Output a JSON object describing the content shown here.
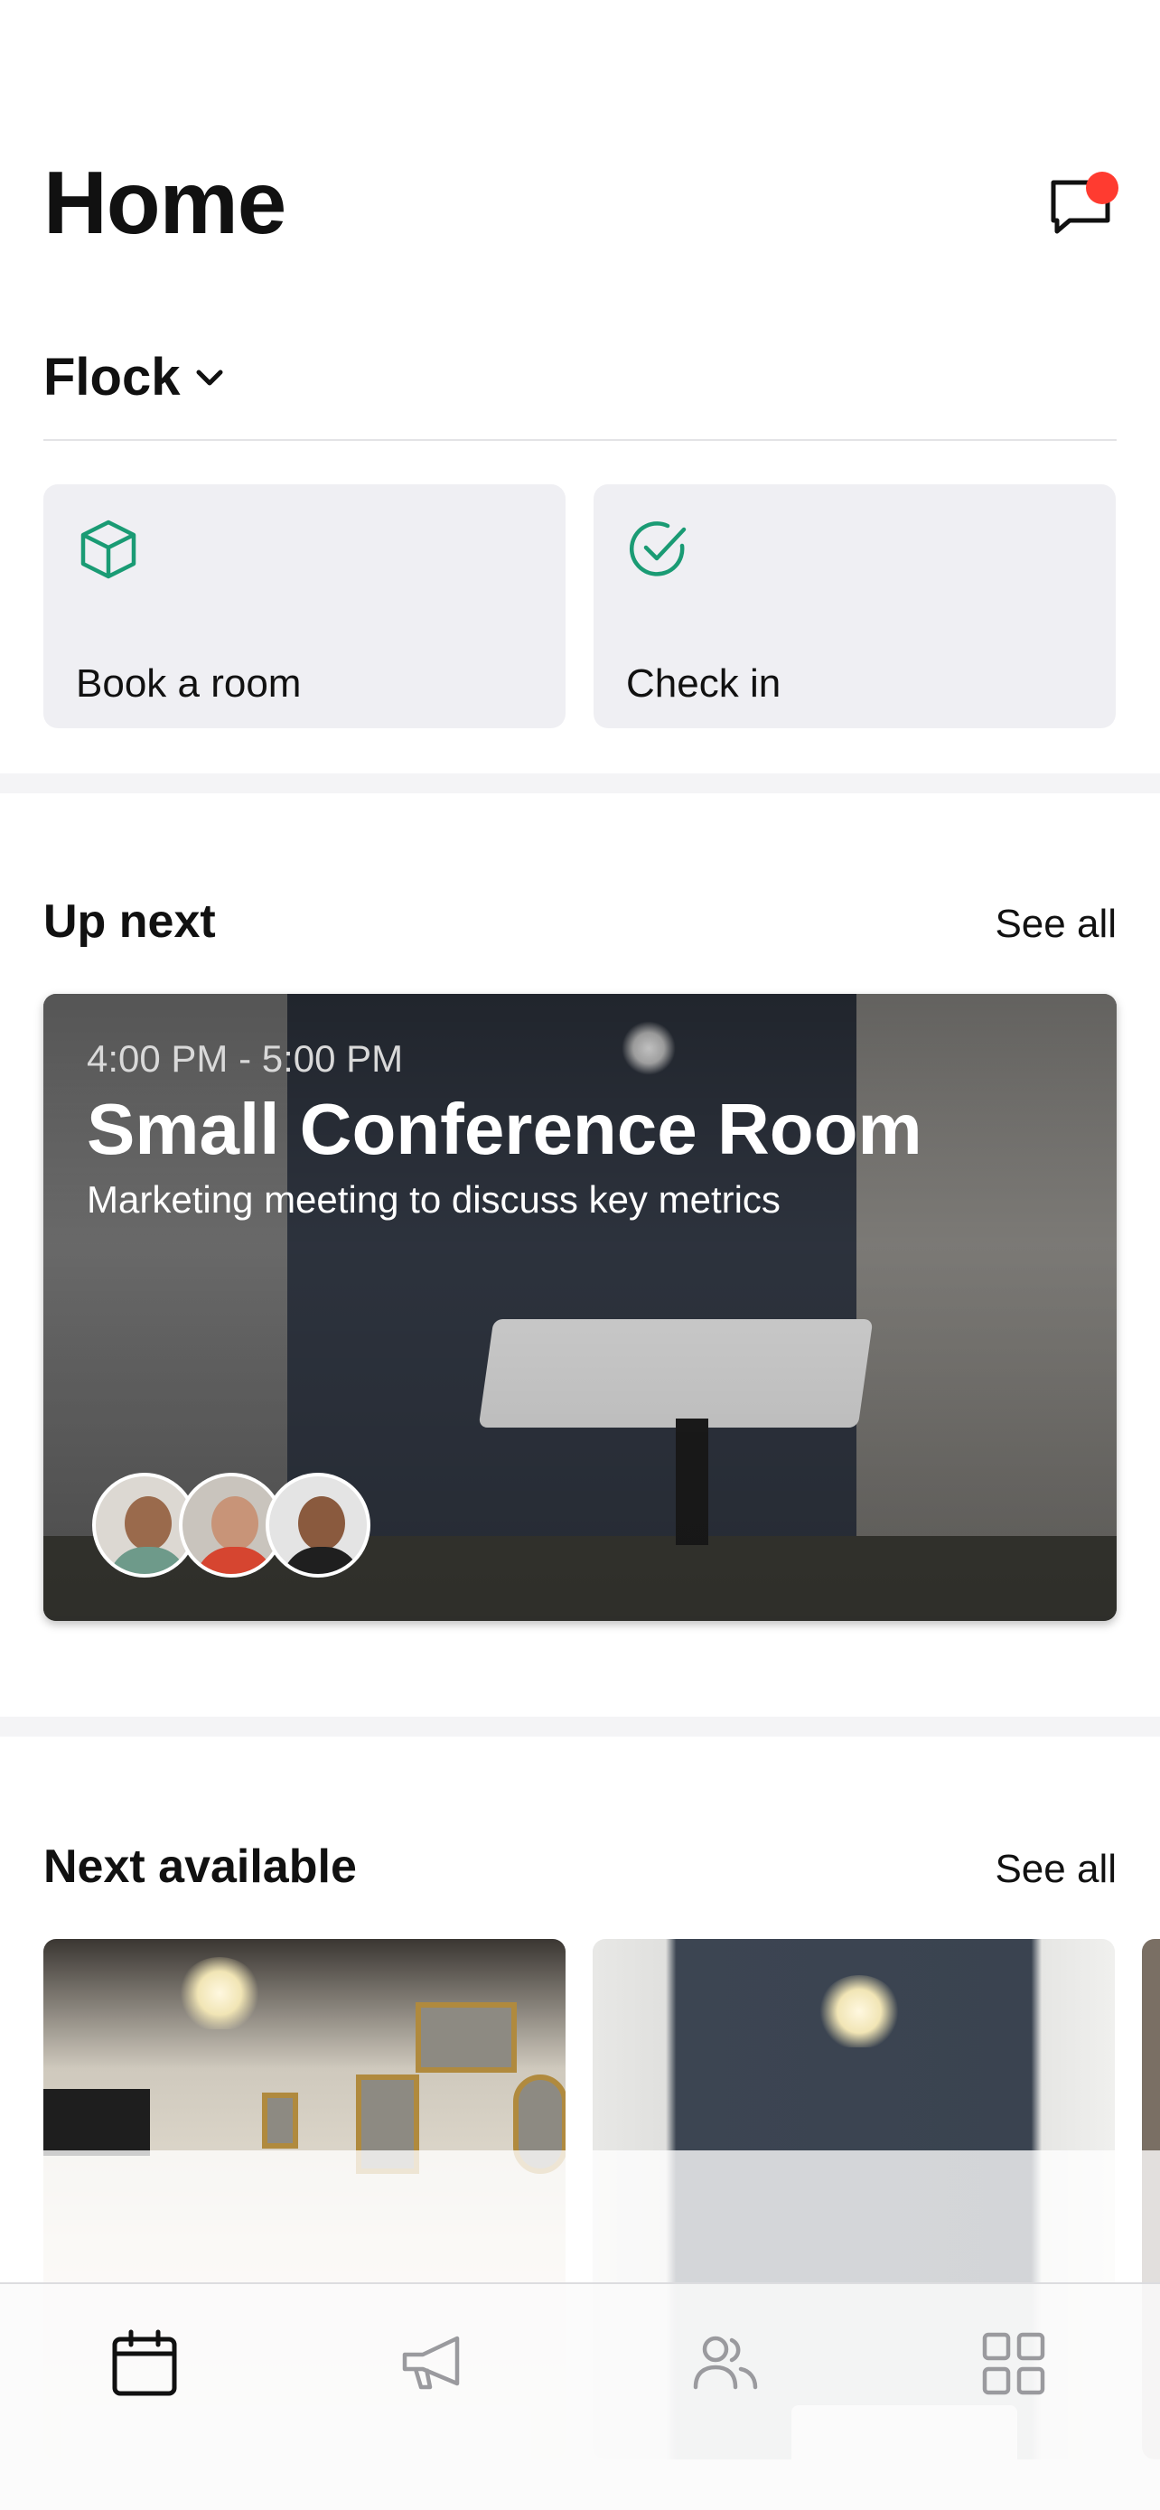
{
  "header": {
    "title": "Home",
    "messages_icon": "message-icon",
    "has_unread": true
  },
  "org_selector": {
    "name": "Flock",
    "icon": "chevron-down-icon"
  },
  "actions": [
    {
      "label": "Book a room",
      "icon": "cube-icon"
    },
    {
      "label": "Check in",
      "icon": "check-circle-icon"
    }
  ],
  "up_next": {
    "title": "Up next",
    "see_all": "See all",
    "booking": {
      "time": "4:00 PM - 5:00 PM",
      "room": "Small Conference Room",
      "description": "Marketing meeting to discuss key metrics",
      "attendee_avatars": 3
    }
  },
  "next_available": {
    "title": "Next available",
    "see_all": "See all"
  },
  "tabbar": {
    "items": [
      {
        "icon": "calendar-icon",
        "active": true
      },
      {
        "icon": "megaphone-icon",
        "active": false
      },
      {
        "icon": "people-icon",
        "active": false
      },
      {
        "icon": "grid-icon",
        "active": false
      }
    ]
  },
  "colors": {
    "accent": "#1a9b74",
    "badge": "#ff3b30",
    "tile_bg": "#efeff3",
    "active_tab": "#111111",
    "inactive_tab": "#9a9a9e"
  }
}
